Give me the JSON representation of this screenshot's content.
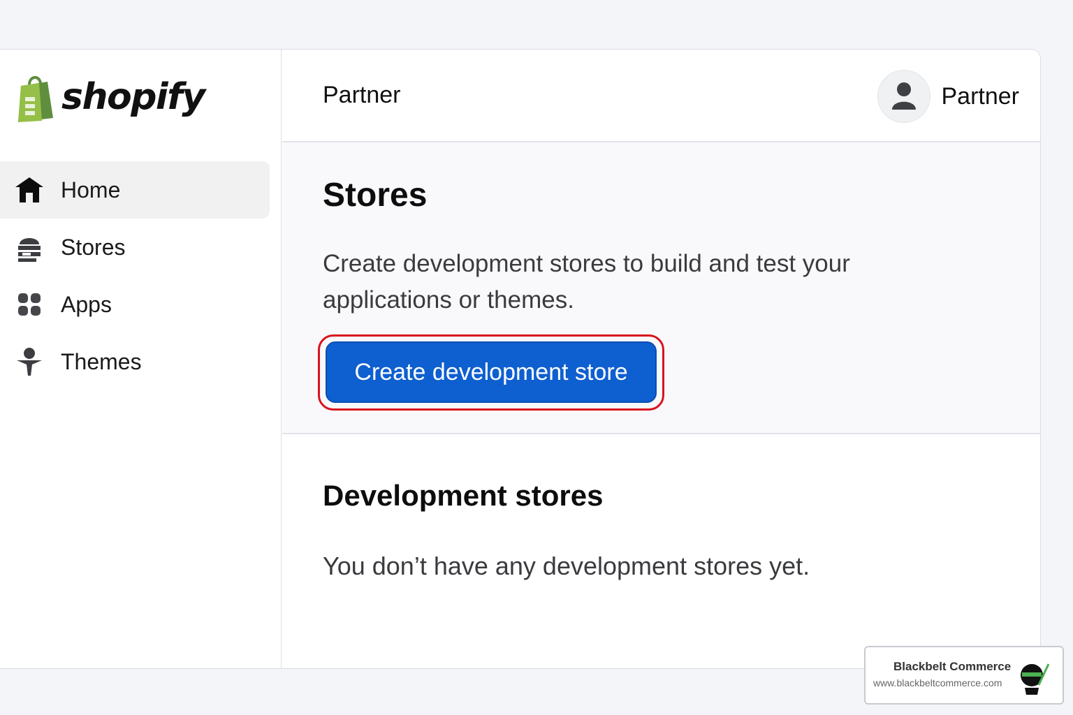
{
  "brand": {
    "wordmark": "shopify",
    "logo_icon": "shopify-bag-icon",
    "logo_color": "#95bf47"
  },
  "sidebar": {
    "items": [
      {
        "label": "Home",
        "icon": "home-icon",
        "active": true
      },
      {
        "label": "Stores",
        "icon": "store-icon",
        "active": false
      },
      {
        "label": "Apps",
        "icon": "apps-grid-icon",
        "active": false
      },
      {
        "label": "Themes",
        "icon": "theme-brush-icon",
        "active": false
      }
    ]
  },
  "header": {
    "title": "Partner",
    "profile_name": "Partner",
    "avatar_icon": "user-avatar-icon"
  },
  "stores_section": {
    "title": "Stores",
    "description": "Create development stores to build and test your applications or themes.",
    "cta_label": "Create development store",
    "cta_color": "#0e5fd0",
    "highlight_color": "#d9131e"
  },
  "dev_stores_section": {
    "title": "Development stores",
    "empty_message": "You don’t have any development stores yet."
  },
  "watermark": {
    "name": "Blackbelt Commerce",
    "url": "www.blackbeltcommerce.com"
  }
}
